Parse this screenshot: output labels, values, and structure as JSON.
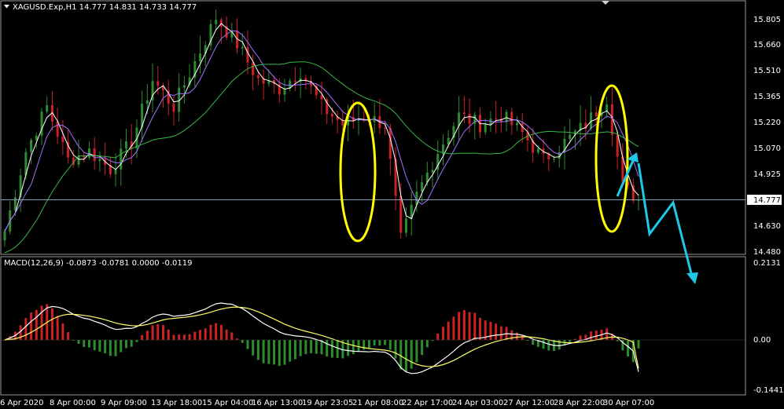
{
  "window": {
    "symbol_header": "XAGUSD.Exp,H1  14.777 14.831 14.733 14.777"
  },
  "macd": {
    "header": "MACD(12,26,9) -0.0873 -0.0781 0.0000 -0.0119"
  },
  "price_axis": {
    "ticks": [
      "15.805",
      "15.660",
      "15.510",
      "15.365",
      "15.220",
      "15.070",
      "14.925",
      "14.630",
      "14.480"
    ],
    "current_price": "14.777"
  },
  "macd_axis": {
    "ticks": [
      "0.2131",
      "0.00",
      "-0.1441"
    ]
  },
  "time_axis": {
    "ticks": [
      "6 Apr 2020",
      "8 Apr 00:00",
      "9 Apr 09:00",
      "13 Apr 18:00",
      "15 Apr 04:00",
      "16 Apr 13:00",
      "19 Apr 23:05",
      "21 Apr 08:00",
      "22 Apr 17:00",
      "24 Apr 03:00",
      "27 Apr 12:00",
      "28 Apr 22:00",
      "30 Apr 07:00"
    ]
  },
  "colors": {
    "background": "#000000",
    "bull_candle": "#2e8b2e",
    "bear_candle": "#cc2222",
    "ma_white": "#ffffff",
    "ma_violet": "#a070ff",
    "ma_green": "#39b54a",
    "macd_main": "#ffffff",
    "macd_signal": "#ffff66",
    "highlight_ellipse": "#ffff00",
    "forecast_arrow": "#1ec8e6",
    "price_line": "#8aa0b4"
  },
  "chart_data": [
    {
      "type": "candlestick",
      "title": "XAGUSD.Exp,H1",
      "ohlc_last": {
        "open": 14.777,
        "high": 14.831,
        "low": 14.733,
        "close": 14.777
      },
      "ylim": [
        14.48,
        15.88
      ],
      "x_labels": [
        "6 Apr 2020",
        "8 Apr 00:00",
        "9 Apr 09:00",
        "13 Apr 18:00",
        "15 Apr 04:00",
        "16 Apr 13:00",
        "19 Apr 23:05",
        "21 Apr 08:00",
        "22 Apr 17:00",
        "24 Apr 03:00",
        "27 Apr 12:00",
        "28 Apr 22:00",
        "30 Apr 07:00"
      ],
      "close_profile": [
        [
          0,
          14.6
        ],
        [
          4,
          15.05
        ],
        [
          8,
          15.3
        ],
        [
          12,
          15.0
        ],
        [
          16,
          15.05
        ],
        [
          20,
          14.95
        ],
        [
          24,
          15.1
        ],
        [
          28,
          15.45
        ],
        [
          32,
          15.3
        ],
        [
          36,
          15.55
        ],
        [
          40,
          15.8
        ],
        [
          44,
          15.65
        ],
        [
          48,
          15.45
        ],
        [
          52,
          15.4
        ],
        [
          56,
          15.5
        ],
        [
          60,
          15.3
        ],
        [
          64,
          15.2
        ],
        [
          68,
          15.25
        ],
        [
          72,
          15.2
        ],
        [
          75,
          14.55
        ],
        [
          78,
          14.8
        ],
        [
          82,
          15.05
        ],
        [
          86,
          15.25
        ],
        [
          90,
          15.2
        ],
        [
          94,
          15.25
        ],
        [
          98,
          15.15
        ],
        [
          102,
          15.0
        ],
        [
          106,
          15.1
        ],
        [
          110,
          15.2
        ],
        [
          114,
          15.35
        ],
        [
          117,
          14.85
        ],
        [
          120,
          14.78
        ]
      ],
      "annotations": [
        "two highlighted sharp sell-offs (yellow ellipses)",
        "forecast zig-zag arrows downward"
      ],
      "current_price": 14.777
    },
    {
      "type": "histogram+line",
      "title": "MACD(12,26,9)",
      "values": {
        "main": -0.0873,
        "signal": -0.0781,
        "histogram": -0.0119
      },
      "ylim": [
        -0.1441,
        0.2131
      ]
    }
  ]
}
